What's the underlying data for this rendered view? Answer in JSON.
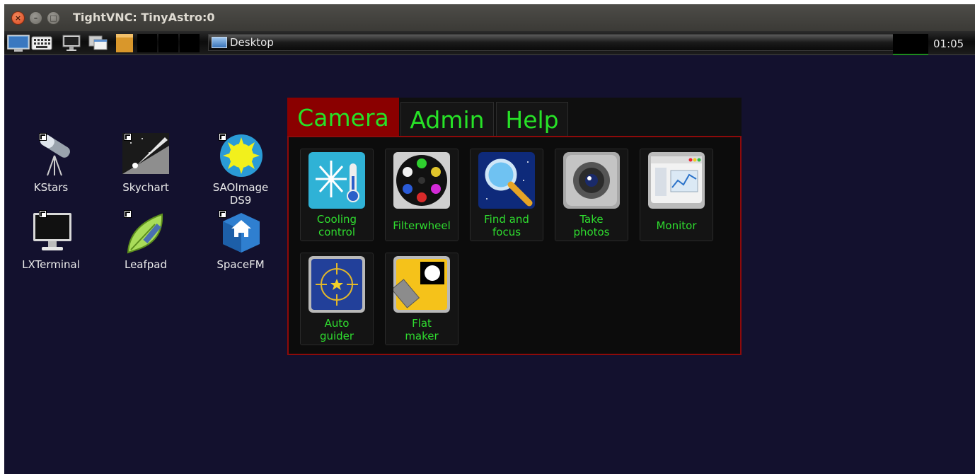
{
  "window": {
    "title": "TightVNC: TinyAstro:0",
    "close_glyph": "×",
    "minimize_glyph": "–",
    "maximize_glyph": "□"
  },
  "taskbar": {
    "launchers": [
      "desktop-show-icon",
      "keyboard-icon",
      "monitor-icon",
      "windows-icon",
      "box-icon"
    ],
    "window_button_label": "Desktop",
    "clock": "01:05"
  },
  "desktop_icons": [
    {
      "label": "KStars",
      "icon": "telescope-icon"
    },
    {
      "label": "Skychart",
      "icon": "comet-icon"
    },
    {
      "label": "SAOImage DS9",
      "icon": "sun-icon"
    },
    {
      "label": "LXTerminal",
      "icon": "terminal-monitor-icon"
    },
    {
      "label": "Leafpad",
      "icon": "leaf-pencil-icon"
    },
    {
      "label": "SpaceFM",
      "icon": "home-cube-icon"
    }
  ],
  "panel": {
    "tabs": [
      {
        "label": "Camera",
        "active": true
      },
      {
        "label": "Admin",
        "active": false
      },
      {
        "label": "Help",
        "active": false
      }
    ],
    "tiles": [
      {
        "label_lines": [
          "Cooling",
          "control"
        ],
        "icon": "snowflake-thermometer-icon"
      },
      {
        "label_lines": [
          "Filterwheel"
        ],
        "icon": "filter-wheel-icon"
      },
      {
        "label_lines": [
          "Find and",
          "focus"
        ],
        "icon": "magnifier-icon"
      },
      {
        "label_lines": [
          "Take",
          "photos"
        ],
        "icon": "camera-lens-icon"
      },
      {
        "label_lines": [
          "Monitor"
        ],
        "icon": "monitor-chart-icon"
      },
      {
        "label_lines": [
          "Auto",
          "guider"
        ],
        "icon": "crosshair-star-icon"
      },
      {
        "label_lines": [
          "Flat",
          "maker"
        ],
        "icon": "flat-panel-icon"
      }
    ]
  },
  "colors": {
    "desktop_bg": "#13112e",
    "tab_active_bg": "#8a0000",
    "panel_border": "#8d0a0a",
    "label_green": "#2fdc2f"
  }
}
